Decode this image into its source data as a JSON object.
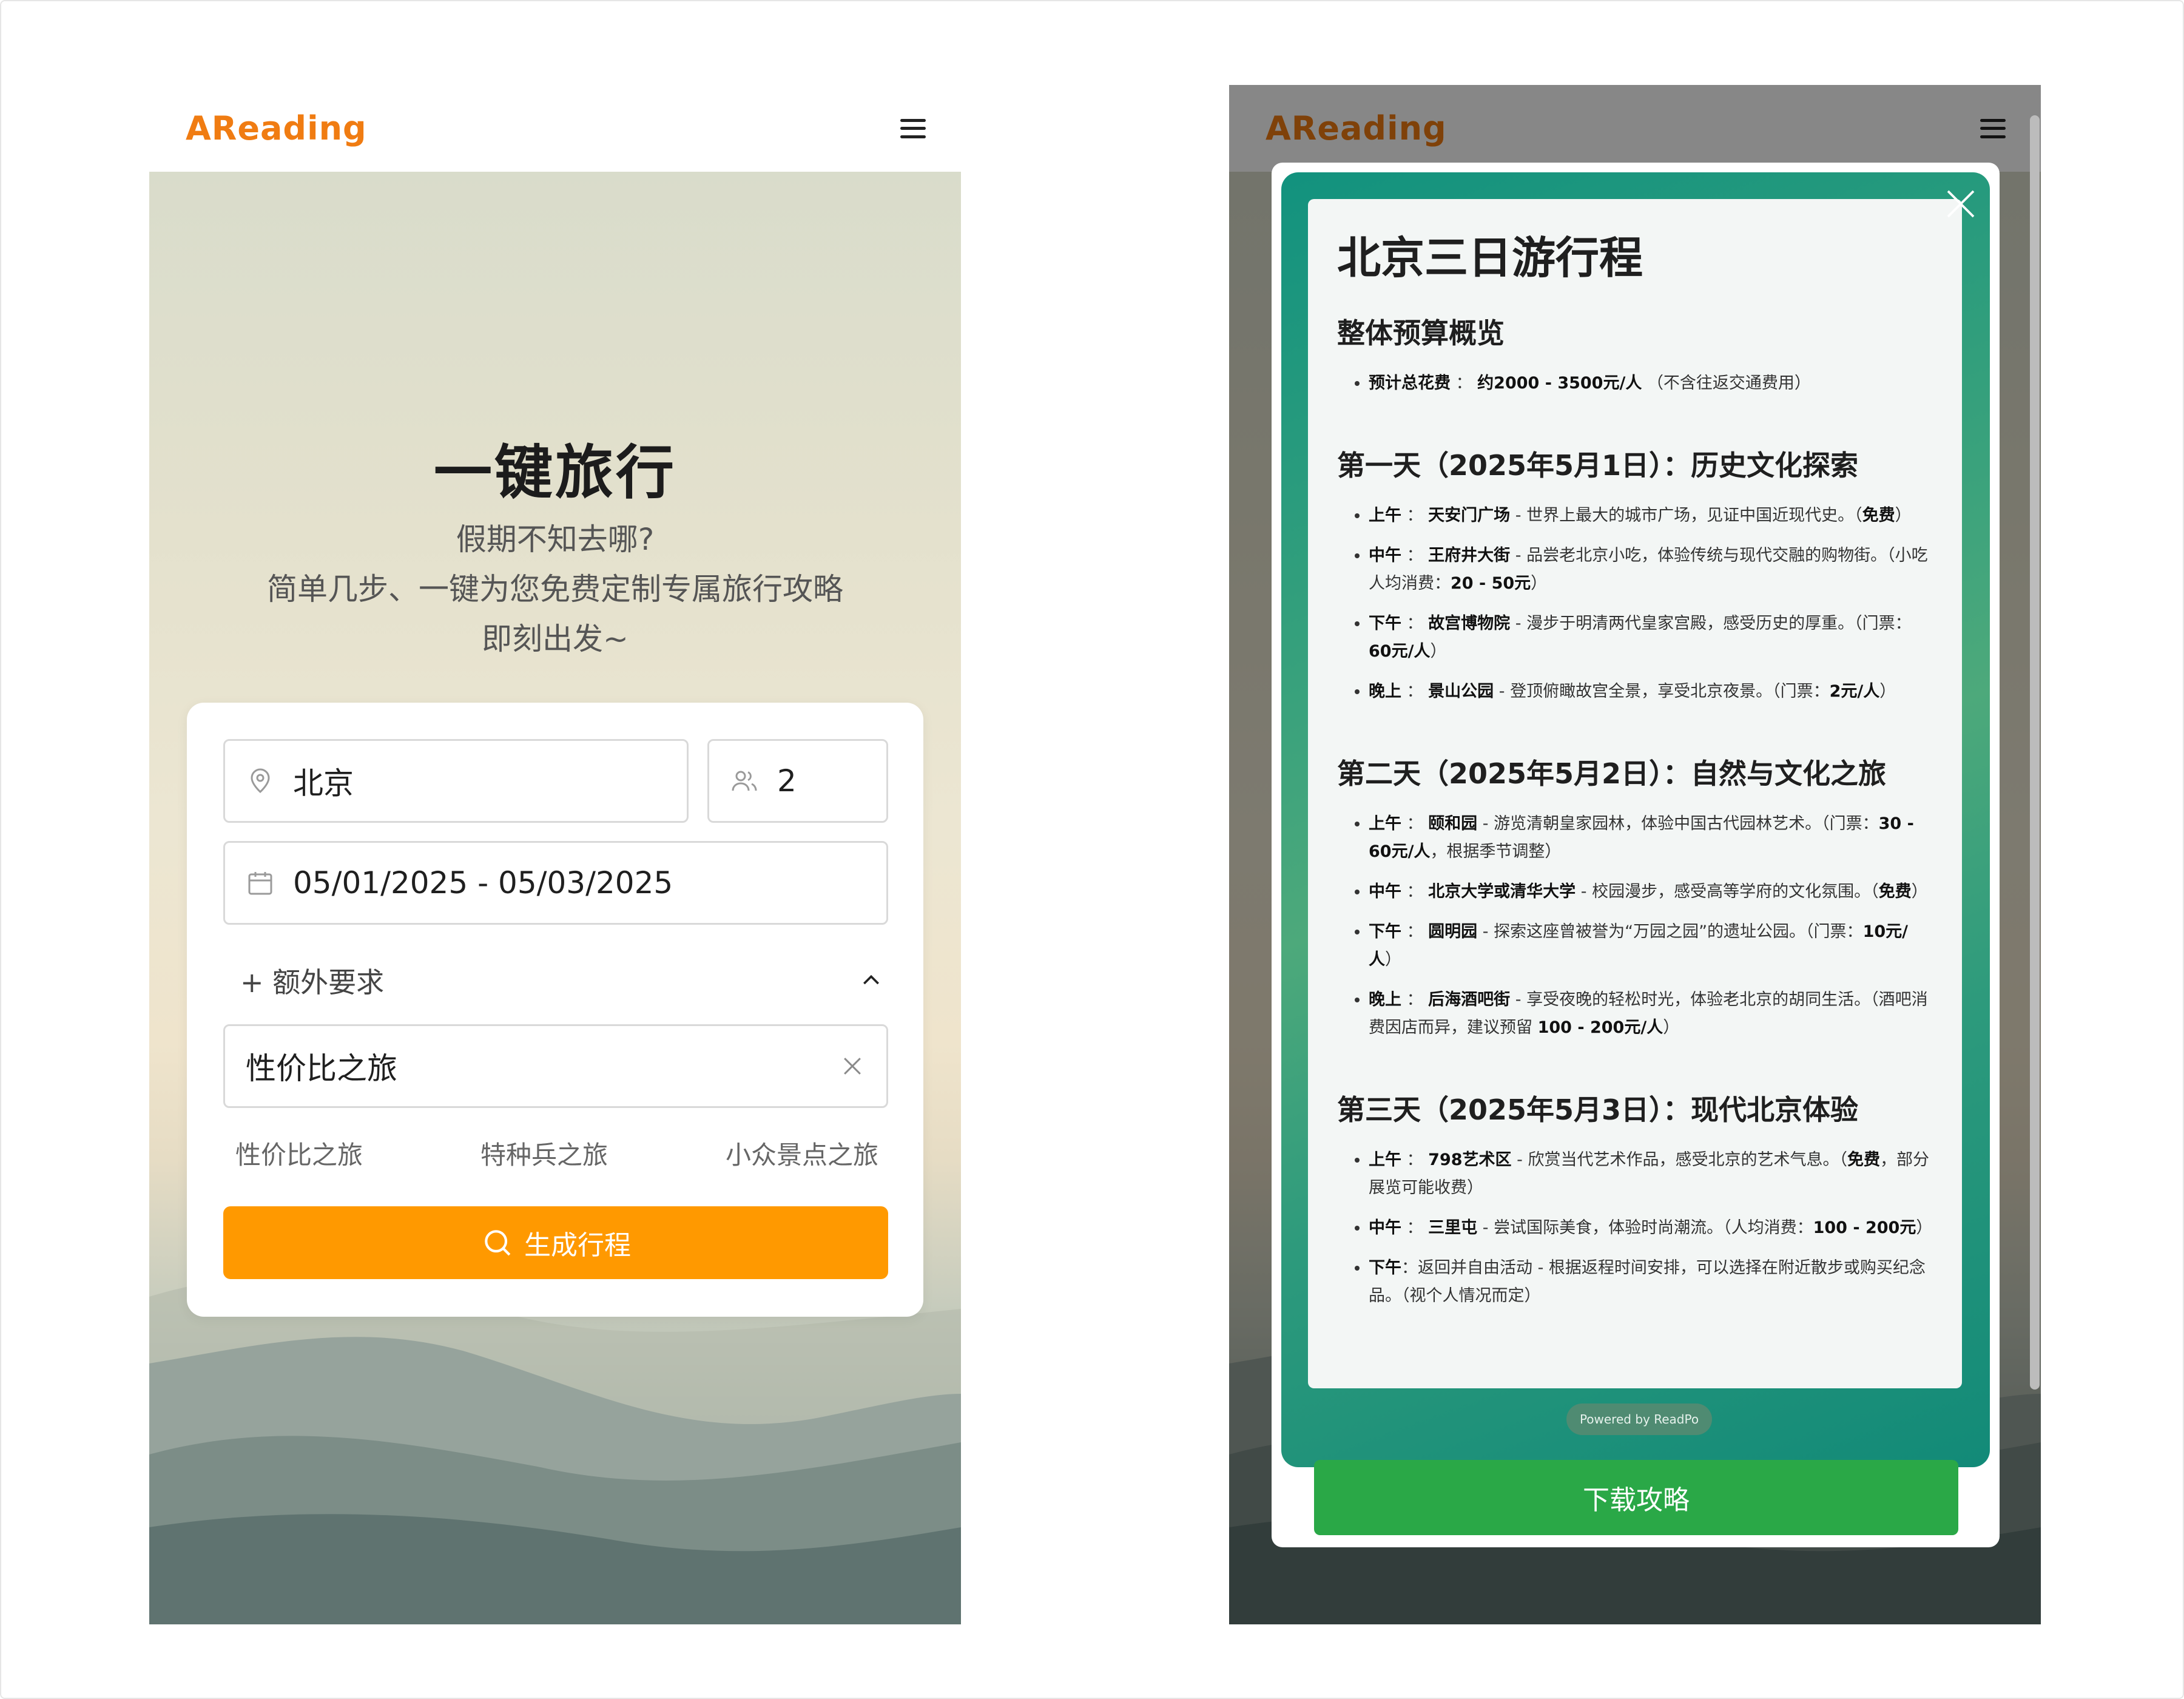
{
  "left_app": {
    "brand": "AReading",
    "hero": {
      "title": "一键旅行",
      "subtitle_lines": [
        "假期不知去哪?",
        "简单几步、一键为您免费定制专属旅行攻略",
        "即刻出发~"
      ]
    },
    "form": {
      "destination": "北京",
      "travelers": "2",
      "date_range": "05/01/2025 - 05/03/2025",
      "extra_label": "+ 额外要求",
      "preference_value": "性价比之旅",
      "chips": [
        "性价比之旅",
        "特种兵之旅",
        "小众景点之旅"
      ],
      "generate_label": "生成行程"
    }
  },
  "right_app": {
    "brand": "AReading",
    "itinerary": {
      "title": "北京三日游行程",
      "budget_heading": "整体预算概览",
      "budget_items": [
        {
          "label": "预计总花费",
          "text": "约2000 - 3500元/人",
          "note": "（不含往返交通费用）"
        }
      ],
      "days": [
        {
          "heading": "第一天（2025年5月1日）：历史文化探索",
          "items": [
            {
              "time": "上午",
              "place": "天安门广场",
              "desc": " - 世界上最大的城市广场，见证中国近现代史。（",
              "bold_tail": "免费",
              "end": "）"
            },
            {
              "time": "中午",
              "place": "王府井大街",
              "desc": " - 品尝老北京小吃，体验传统与现代交融的购物街。（小吃人均消费：",
              "bold_tail": "20 - 50元",
              "end": "）"
            },
            {
              "time": "下午",
              "place": "故宫博物院",
              "desc": " - 漫步于明清两代皇家宫殿，感受历史的厚重。（门票：",
              "bold_tail": "60元/人",
              "end": "）"
            },
            {
              "time": "晚上",
              "place": "景山公园",
              "desc": " - 登顶俯瞰故宫全景，享受北京夜景。（门票：",
              "bold_tail": "2元/人",
              "end": "）"
            }
          ]
        },
        {
          "heading": "第二天（2025年5月2日）：自然与文化之旅",
          "items": [
            {
              "time": "上午",
              "place": "颐和园",
              "desc": " - 游览清朝皇家园林，体验中国古代园林艺术。（门票：",
              "bold_tail": "30 - 60元/人",
              "end": "，根据季节调整）"
            },
            {
              "time": "中午",
              "place": "北京大学或清华大学",
              "desc": " - 校园漫步，感受高等学府的文化氛围。（",
              "bold_tail": "免费",
              "end": "）"
            },
            {
              "time": "下午",
              "place": "圆明园",
              "desc": " - 探索这座曾被誉为“万园之园”的遗址公园。（门票：",
              "bold_tail": "10元/人",
              "end": "）"
            },
            {
              "time": "晚上",
              "place": "后海酒吧街",
              "desc": " - 享受夜晚的轻松时光，体验老北京的胡同生活。（酒吧消费因店而异，建议预留 ",
              "bold_tail": "100 - 200元/人",
              "end": "）"
            }
          ]
        },
        {
          "heading": "第三天（2025年5月3日）：现代北京体验",
          "items": [
            {
              "time": "上午",
              "place": "798艺术区",
              "desc": " - 欣赏当代艺术作品，感受北京的艺术气息。（",
              "bold_tail": "免费",
              "end": "，部分展览可能收费）"
            },
            {
              "time": "中午",
              "place": "三里屯",
              "desc": " - 尝试国际美食，体验时尚潮流。（人均消费：",
              "bold_tail": "100 - 200元",
              "end": "）"
            },
            {
              "time": "下午",
              "place": "",
              "desc": "：返回并自由活动 - 根据返程时间安排，可以选择在附近散步或购买纪念品。（视个人情况而定）",
              "bold_tail": "",
              "end": ""
            }
          ]
        }
      ]
    },
    "powered_by": "Powered by ReadPo",
    "download_label": "下载攻略"
  },
  "colors": {
    "brand": "#f07c12",
    "generate_button": "#ff9900",
    "download_button": "#2aa847",
    "modal_gradient": "#12927e"
  },
  "icons": {
    "menu": "hamburger-icon",
    "location": "map-pin-icon",
    "travelers": "users-icon",
    "calendar": "calendar-icon",
    "collapse": "chevron-up-icon",
    "clear": "close-icon",
    "search": "search-icon",
    "modal_close": "close-icon"
  }
}
